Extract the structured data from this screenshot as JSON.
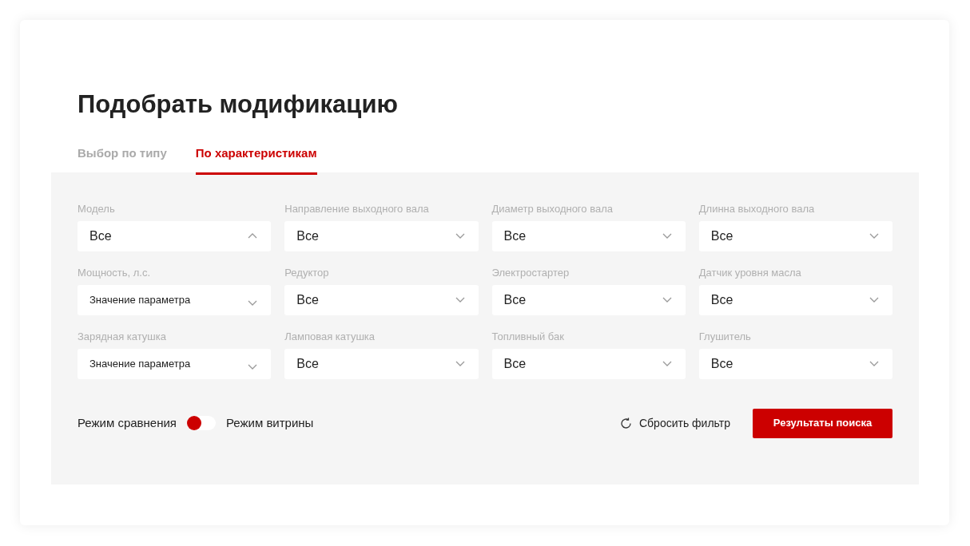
{
  "title": "Подобрать модификацию",
  "tabs": [
    {
      "label": "Выбор по типу",
      "selected": false
    },
    {
      "label": "По характеристикам",
      "selected": true
    }
  ],
  "filters": [
    {
      "label": "Модель",
      "value": "Все",
      "expanded": true
    },
    {
      "label": "Направление выходного вала",
      "value": "Все",
      "expanded": false
    },
    {
      "label": "Диаметр выходного вала",
      "value": "Все",
      "expanded": false
    },
    {
      "label": "Длинна выходного вала",
      "value": "Все",
      "expanded": false
    },
    {
      "label": "Мощность, л.с.",
      "placeholder": "Значение параметра",
      "expanded": false
    },
    {
      "label": "Редуктор",
      "value": "Все",
      "expanded": false
    },
    {
      "label": "Электростартер",
      "value": "Все",
      "expanded": false
    },
    {
      "label": "Датчик уровня масла",
      "value": "Все",
      "expanded": false
    },
    {
      "label": "Зарядная катушка",
      "placeholder": "Значение параметра",
      "expanded": false
    },
    {
      "label": "Ламповая катушка",
      "value": "Все",
      "expanded": false
    },
    {
      "label": "Топливный бак",
      "value": "Все",
      "expanded": false
    },
    {
      "label": "Глушитель",
      "value": "Все",
      "expanded": false
    }
  ],
  "mode_switch": {
    "left_label": "Режим сравнения",
    "right_label": "Режим витрины",
    "on": false
  },
  "reset_button": "Сбросить фильтр",
  "search_button": "Результаты поиска"
}
